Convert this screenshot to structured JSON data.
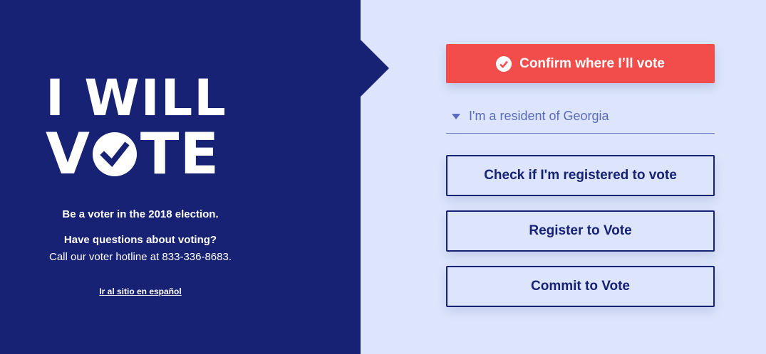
{
  "brand": {
    "line1": "I WILL",
    "line2_prefix": "V",
    "line2_suffix": "TE",
    "logo_check_icon": "check-circle-icon",
    "panel_color": "#172275"
  },
  "info": {
    "voter_line": "Be a voter in the 2018 election.",
    "questions_line": "Have questions about voting?",
    "hotline_line": "Call our voter hotline at 833-336-8683.",
    "spanish_link": "Ir al sitio en español"
  },
  "actions": {
    "confirm_label": "Confirm where I’ll vote",
    "confirm_icon": "check-circle-icon",
    "confirm_color": "#f24c4b",
    "state_select_value": "I'm a resident of Georgia",
    "check_registered_label": "Check if I'm registered to vote",
    "register_label": "Register to Vote",
    "commit_label": "Commit to Vote"
  }
}
